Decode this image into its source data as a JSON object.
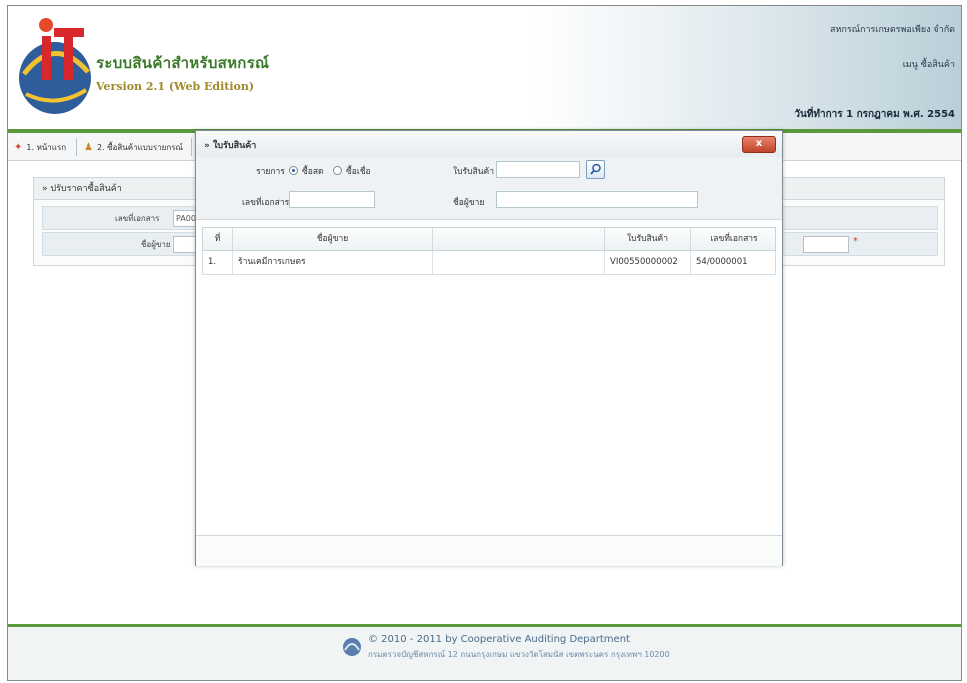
{
  "header": {
    "title": "ระบบสินค้าสำหรับสหกรณ์",
    "version": "Version 2.1 (Web Edition)",
    "coop_name": "สหกรณ์การเกษตรพอเพียง จำกัด",
    "menu_label": "เมนู ซื้อสินค้า",
    "date_text": "วันที่ทำการ 1 กรกฎาคม พ.ศ. 2554"
  },
  "tabs": [
    {
      "label": "1. หน้าแรก",
      "icon": "home-icon"
    },
    {
      "label": "2. ซื้อสินค้าแบบรายกรณ์",
      "icon": "user-icon"
    }
  ],
  "panel": {
    "title": "» ปรับราคาซื้อสินค้า",
    "doc_no_label": "เลขที่เอกสาร",
    "doc_no_value": "PA00",
    "seller_label": "ชื่อผู้ขาย"
  },
  "dialog": {
    "title": "» ใบรับสินค้า",
    "list_label": "รายการ",
    "radio_options": [
      {
        "label": "ซื้อสด",
        "checked": true
      },
      {
        "label": "ซื้อเชื่อ",
        "checked": false
      }
    ],
    "receipt_label": "ใบรับสินค้า",
    "receipt_value": "",
    "doc_no_label": "เลขที่เอกสาร",
    "doc_no_value": "",
    "seller_label": "ชื่อผู้ขาย",
    "seller_value": "",
    "close_label": "x",
    "table": {
      "headers": [
        "ที่",
        "ชื่อผู้ขาย",
        "",
        "ใบรับสินค้า",
        "เลขที่เอกสาร"
      ],
      "rows": [
        [
          "1.",
          "ร้านเคมีการเกษตร",
          "",
          "VI00550000002",
          "54/0000001"
        ]
      ]
    }
  },
  "footer": {
    "copyright": "© 2010 - 2011  by Cooperative Auditing Department",
    "address": "กรมตรวจบัญชีสหกรณ์ 12 ถนนกรุงเกษม แขวงวัดโสมนัส เขตพระนคร กรุงเทพฯ 10200"
  },
  "colors": {
    "accent_green": "#5a9a3c",
    "title_green": "#3b7a2a",
    "version_gold": "#a08a2a",
    "close_red": "#c0442a"
  }
}
